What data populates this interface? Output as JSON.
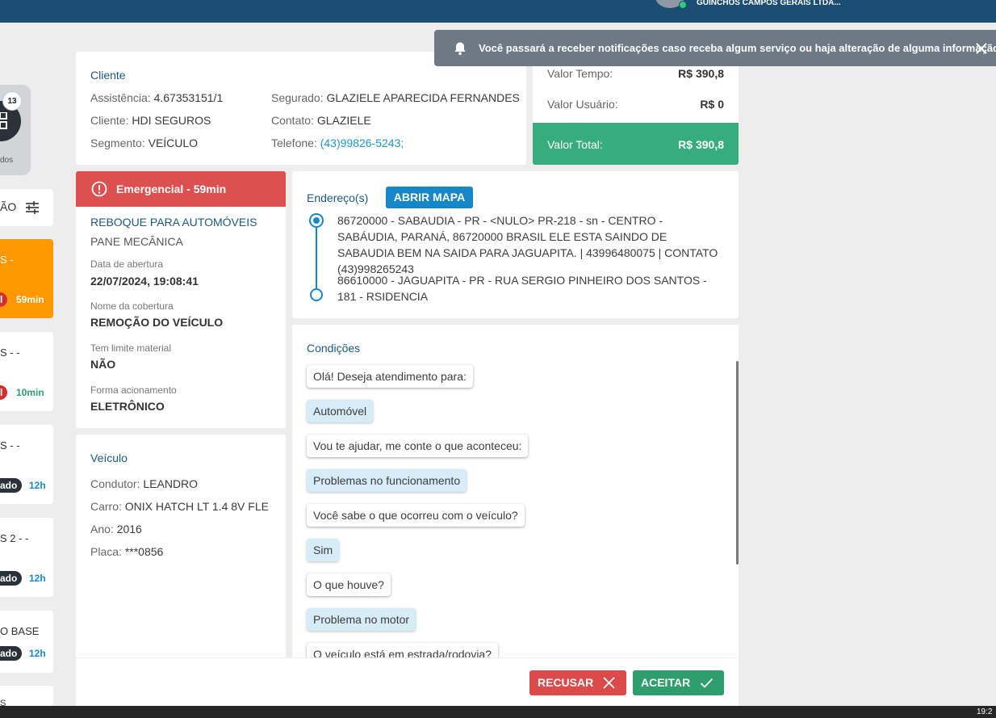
{
  "topbar": {
    "company": "GUINCHOS CAMPOS GERAIS LTDA..."
  },
  "notification": {
    "icon": "bell-icon",
    "message": "Você passará a receber notificações caso receba algum serviço ou haja alteração de alguma informação",
    "close_icon": "close-icon"
  },
  "sidebar": {
    "badge_count": "13",
    "badge_label": "dos",
    "filter_label": "ÃO",
    "cards": [
      {
        "title": "S -",
        "status": "l",
        "time": "59min",
        "active": true
      },
      {
        "title": "S - -",
        "status": "l",
        "time": "10min"
      },
      {
        "title": "S - -",
        "status": "ado",
        "time": "12h"
      },
      {
        "title": "S 2 - -",
        "status": "ado",
        "time": "12h"
      },
      {
        "title": "O BASE",
        "status": "ado",
        "time": "12h"
      },
      {
        "title": "S"
      }
    ]
  },
  "cliente": {
    "title": "Cliente",
    "assistencia_label": "Assistência:",
    "assistencia": "4.67353151/1",
    "cliente_label": "Cliente:",
    "cliente": "HDI SEGUROS",
    "segmento_label": "Segmento:",
    "segmento": "VEÍCULO",
    "segurado_label": "Segurado:",
    "segurado": "GLAZIELE APARECIDA FERNANDES",
    "contato_label": "Contato:",
    "contato": "GLAZIELE",
    "telefone_label": "Telefone:",
    "telefone": "(43)99826-5243;"
  },
  "valores": {
    "tempo_label": "Valor Tempo:",
    "tempo": "R$ 390,8",
    "usuario_label": "Valor Usuário:",
    "usuario": "R$ 0",
    "total_label": "Valor Total:",
    "total": "R$ 390,8"
  },
  "servico": {
    "emergencia": "Emergencial - 59min",
    "tipo": "REBOQUE PARA AUTOMÓVEIS",
    "subtipo": "PANE MECÂNICA",
    "abertura_label": "Data de abertura",
    "abertura": "22/07/2024, 19:08:41",
    "cobertura_label": "Nome da cobertura",
    "cobertura": "REMOÇÃO DO VEÍCULO",
    "limite_label": "Tem limite material",
    "limite": "NÃO",
    "acionamento_label": "Forma acionamento",
    "acionamento": "ELETRÔNICO"
  },
  "veiculo": {
    "title": "Veículo",
    "condutor_label": "Condutor:",
    "condutor": "LEANDRO",
    "carro_label": "Carro:",
    "carro": "ONIX HATCH LT 1.4 8V FLE",
    "ano_label": "Ano:",
    "ano": "2016",
    "placa_label": "Placa:",
    "placa": "***0856"
  },
  "enderecos": {
    "title": "Endereço(s)",
    "map_button": "ABRIR MAPA",
    "origem": "86720000 - SABAUDIA - PR - <NULO> PR-218 - sn - CENTRO - SABÁUDIA, PARANÁ, 86720000 BRASIL ELE ESTA SAINDO DE SABAUDIA BEM NA SAIDA PARA JAGUAPITA. | 43996480075 | CONTATO (43)998265243",
    "destino": "86610000 - JAGUAPITA - PR - RUA SERGIO PINHEIRO DOS SANTOS - 181 - RSIDENCIA"
  },
  "condicoes": {
    "title": "Condições",
    "messages": [
      {
        "type": "q",
        "text": "Olá! Deseja atendimento para:"
      },
      {
        "type": "a",
        "text": "Automóvel"
      },
      {
        "type": "q",
        "text": "Vou te ajudar, me conte o que aconteceu:"
      },
      {
        "type": "a",
        "text": "Problemas no funcionamento"
      },
      {
        "type": "q",
        "text": "Você sabe o que ocorreu com o veículo?"
      },
      {
        "type": "a",
        "text": "Sim"
      },
      {
        "type": "q",
        "text": "O que houve?"
      },
      {
        "type": "a",
        "text": "Problema no motor"
      },
      {
        "type": "q",
        "text": "O veículo está em estrada/rodovia?"
      }
    ]
  },
  "actions": {
    "recusar": "RECUSAR",
    "aceitar": "ACEITAR"
  },
  "taskbar": {
    "clock": "19:2"
  },
  "colors": {
    "header": "#1c4e74",
    "emergency": "#dc5050",
    "total": "#37ad7e",
    "accept": "#2f9e6e",
    "reject": "#dc4a4a",
    "link": "#1688c9"
  }
}
